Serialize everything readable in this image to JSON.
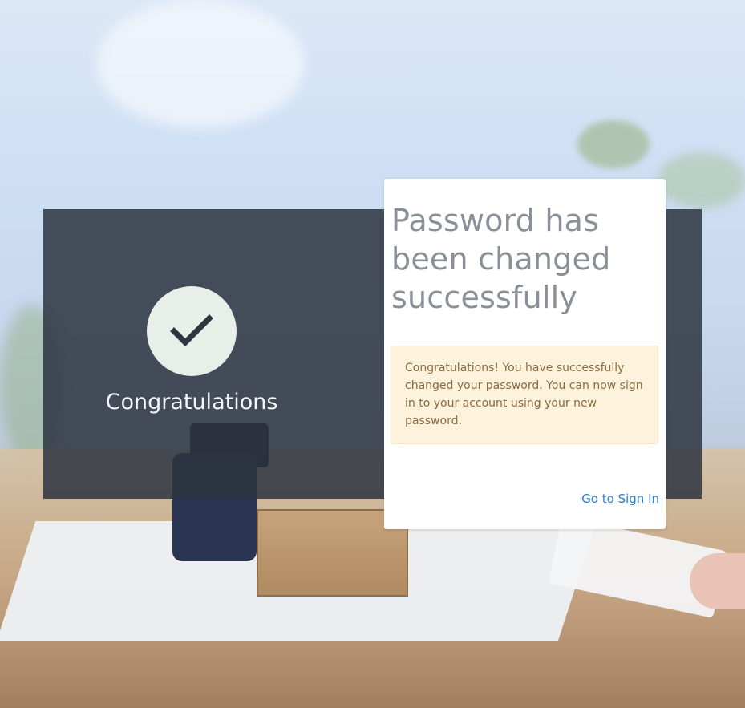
{
  "background": {
    "description_icon": "background-photo"
  },
  "banner": {
    "heading": "Congratulations",
    "icon": "checkmark-icon"
  },
  "card": {
    "title": "Password has been changed successfully",
    "alert_text": "Congratulations! You have successfully changed your password. You can now sign in to your account using your new password.",
    "signin_link_label": "Go to Sign In"
  },
  "colors": {
    "panel": "#2d3440",
    "title": "#8a9097",
    "alert_bg": "#fdf3dc",
    "alert_text": "#8b6a3e",
    "link": "#2d7fd6"
  }
}
